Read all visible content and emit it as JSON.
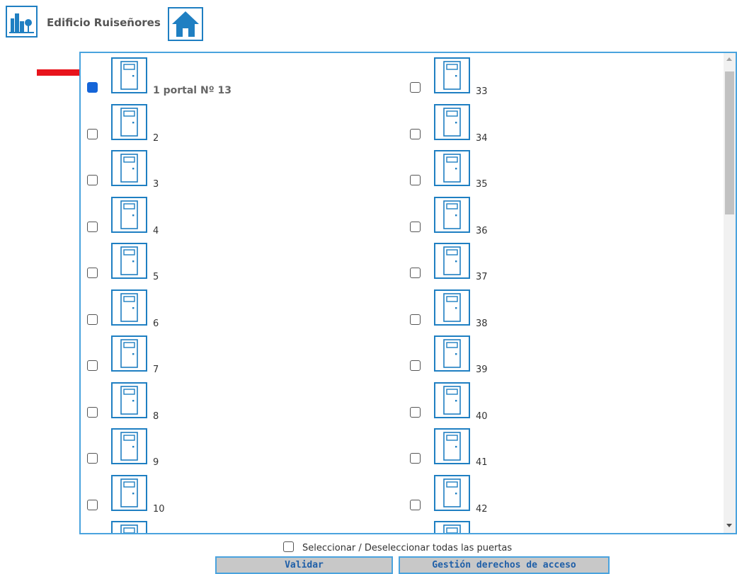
{
  "header": {
    "building_icon": "building-trees-icon",
    "title": "Edificio Ruiseñores",
    "home_icon": "home-icon"
  },
  "doors": {
    "left": [
      {
        "label": "1 portal Nº 13",
        "checked": true
      },
      {
        "label": "2",
        "checked": false
      },
      {
        "label": "3",
        "checked": false
      },
      {
        "label": "4",
        "checked": false
      },
      {
        "label": "5",
        "checked": false
      },
      {
        "label": "6",
        "checked": false
      },
      {
        "label": "7",
        "checked": false
      },
      {
        "label": "8",
        "checked": false
      },
      {
        "label": "9",
        "checked": false
      },
      {
        "label": "10",
        "checked": false
      }
    ],
    "right": [
      {
        "label": "33",
        "checked": false
      },
      {
        "label": "34",
        "checked": false
      },
      {
        "label": "35",
        "checked": false
      },
      {
        "label": "36",
        "checked": false
      },
      {
        "label": "37",
        "checked": false
      },
      {
        "label": "38",
        "checked": false
      },
      {
        "label": "39",
        "checked": false
      },
      {
        "label": "40",
        "checked": false
      },
      {
        "label": "41",
        "checked": false
      },
      {
        "label": "42",
        "checked": false
      }
    ]
  },
  "footer": {
    "select_all_label": "Seleccionar / Deseleccionar todas las puertas",
    "validar_label": "Validar",
    "gestion_label": "Gestión derechos de acceso"
  },
  "colors": {
    "accent": "#1f7fc2",
    "panel_border": "#4aa3de",
    "checkbox_checked": "#1565d8",
    "arrow": "#e8141c"
  }
}
